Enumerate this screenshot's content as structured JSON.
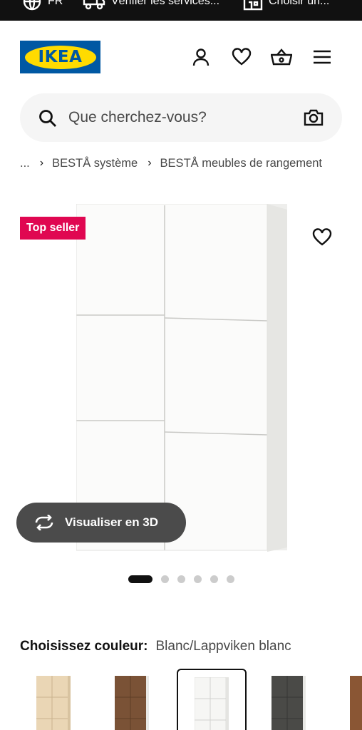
{
  "topbar": {
    "items": [
      {
        "icon": "globe-icon",
        "label": "FR"
      },
      {
        "icon": "truck-icon",
        "label": "Vérifier les services..."
      },
      {
        "icon": "store-icon",
        "label": "Choisir un..."
      }
    ]
  },
  "header": {
    "logo_text": "IKEA",
    "icons": [
      "user-icon",
      "heart-icon",
      "basket-icon",
      "menu-icon"
    ]
  },
  "search": {
    "placeholder": "Que cherchez-vous?"
  },
  "breadcrumb": {
    "ellipsis": "...",
    "items": [
      "BESTÅ système",
      "BESTÅ meubles de rangement"
    ],
    "separator": "›"
  },
  "product": {
    "badge": "Top seller",
    "view3d_label": "Visualiser en 3D",
    "carousel": {
      "total": 6,
      "active": 1
    }
  },
  "color": {
    "label": "Choisissez couleur:",
    "value": "Blanc/Lappviken blanc",
    "swatches": [
      {
        "name": "oak-effect",
        "color": "#ead6b5",
        "selected": false
      },
      {
        "name": "walnut",
        "color": "#7a5236",
        "selected": false
      },
      {
        "name": "white",
        "color": "#f6f6f4",
        "selected": true
      },
      {
        "name": "dark-grey",
        "color": "#4a4a47",
        "selected": false
      },
      {
        "name": "brown",
        "color": "#8a5634",
        "selected": false
      }
    ]
  },
  "colors": {
    "badge": "#e00751",
    "topbar_bg": "#111111",
    "logo_blue": "#0058a3",
    "logo_yellow": "#ffdb00"
  }
}
